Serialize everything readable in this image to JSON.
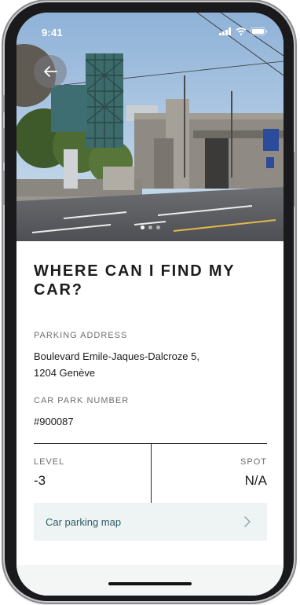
{
  "status": {
    "time": "9:41"
  },
  "icons": {
    "back": "arrow-left-icon",
    "chevron": "chevron-right-icon",
    "signal": "signal-icon",
    "wifi": "wifi-icon",
    "battery": "battery-icon"
  },
  "carousel": {
    "total": 3,
    "active": 1
  },
  "page": {
    "title": "WHERE CAN I FIND MY CAR?"
  },
  "address": {
    "label": "PARKING ADDRESS",
    "line1": "Boulevard Emile-Jaques-Dalcroze 5,",
    "line2": "1204 Genève"
  },
  "car_park": {
    "label": "CAR PARK NUMBER",
    "value": "#900087"
  },
  "level": {
    "label": "LEVEL",
    "value": "-3"
  },
  "spot": {
    "label": "SPOT",
    "value": "N/A"
  },
  "map": {
    "label": "Car parking map"
  },
  "colors": {
    "accent_text": "#2f5d6c",
    "map_bg": "#eef3f3"
  }
}
